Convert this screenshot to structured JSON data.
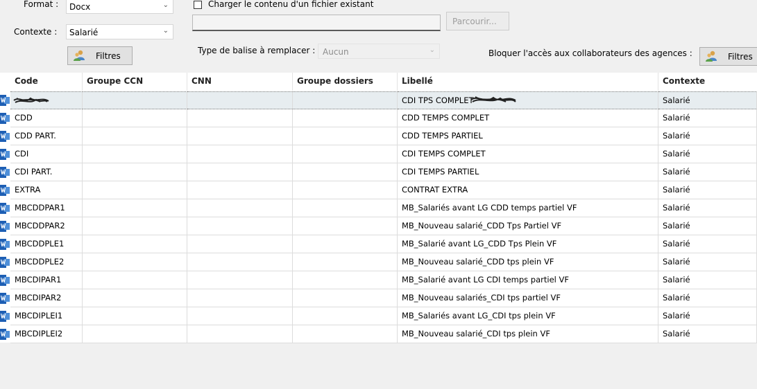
{
  "toolbar": {
    "format_label": "Format :",
    "format_value": "Docx",
    "contexte_label": "Contexte :",
    "contexte_value": "Salarié",
    "filtres_label": "Filtres",
    "load_checkbox_label": "Charger le contenu d'un fichier existant",
    "file_path_value": "",
    "browse_label": "Parcourir...",
    "tag_type_label": "Type de balise à remplacer :",
    "tag_type_value": "Aucun",
    "block_access_label": "Bloquer l'accès aux collaborateurs des agences :",
    "filtres_right_label": "Filtres"
  },
  "table": {
    "columns": [
      "Code",
      "Groupe CCN",
      "CNN",
      "Groupe dossiers",
      "Libellé",
      "Contexte"
    ],
    "rows": [
      {
        "code": "",
        "groupe_ccn": "",
        "cnn": "",
        "groupe_dossiers": "",
        "libelle": "CDI TPS COMPLET",
        "contexte": "Salarié"
      },
      {
        "code": "CDD",
        "groupe_ccn": "",
        "cnn": "",
        "groupe_dossiers": "",
        "libelle": "CDD TEMPS COMPLET",
        "contexte": "Salarié"
      },
      {
        "code": "CDD PART.",
        "groupe_ccn": "",
        "cnn": "",
        "groupe_dossiers": "",
        "libelle": "CDD TEMPS PARTIEL",
        "contexte": "Salarié"
      },
      {
        "code": "CDI",
        "groupe_ccn": "",
        "cnn": "",
        "groupe_dossiers": "",
        "libelle": "CDI TEMPS COMPLET",
        "contexte": "Salarié"
      },
      {
        "code": "CDI PART.",
        "groupe_ccn": "",
        "cnn": "",
        "groupe_dossiers": "",
        "libelle": "CDI TEMPS PARTIEL",
        "contexte": "Salarié"
      },
      {
        "code": "EXTRA",
        "groupe_ccn": "",
        "cnn": "",
        "groupe_dossiers": "",
        "libelle": "CONTRAT EXTRA",
        "contexte": "Salarié"
      },
      {
        "code": "MBCDDPAR1",
        "groupe_ccn": "",
        "cnn": "",
        "groupe_dossiers": "",
        "libelle": "MB_Salariés avant LG CDD temps partiel VF",
        "contexte": "Salarié"
      },
      {
        "code": "MBCDDPAR2",
        "groupe_ccn": "",
        "cnn": "",
        "groupe_dossiers": "",
        "libelle": "MB_Nouveau salarié_CDD Tps Partiel VF",
        "contexte": "Salarié"
      },
      {
        "code": "MBCDDPLE1",
        "groupe_ccn": "",
        "cnn": "",
        "groupe_dossiers": "",
        "libelle": "MB_Salarié avant LG_CDD Tps Plein VF",
        "contexte": "Salarié"
      },
      {
        "code": "MBCDDPLE2",
        "groupe_ccn": "",
        "cnn": "",
        "groupe_dossiers": "",
        "libelle": "MB_Nouveau salarié_CDD tps plein VF",
        "contexte": "Salarié"
      },
      {
        "code": "MBCDIPAR1",
        "groupe_ccn": "",
        "cnn": "",
        "groupe_dossiers": "",
        "libelle": "MB_Salarié avant LG CDI temps partiel VF",
        "contexte": "Salarié"
      },
      {
        "code": "MBCDIPAR2",
        "groupe_ccn": "",
        "cnn": "",
        "groupe_dossiers": "",
        "libelle": "MB_Nouveau salariés_CDI tps partiel VF",
        "contexte": "Salarié"
      },
      {
        "code": "MBCDIPLEI1",
        "groupe_ccn": "",
        "cnn": "",
        "groupe_dossiers": "",
        "libelle": "MB_Salariés avant LG_CDI tps plein VF",
        "contexte": "Salarié"
      },
      {
        "code": "MBCDIPLEI2",
        "groupe_ccn": "",
        "cnn": "",
        "groupe_dossiers": "",
        "libelle": "MB_Nouveau salarié_CDI tps plein VF",
        "contexte": "Salarié"
      }
    ]
  },
  "icons": {
    "filter": "users-filter-icon",
    "row": "word-document-icon",
    "chevron": "chevron-down-icon"
  },
  "colors": {
    "selected_row": "#e7edf0",
    "word_icon": "#1e5fb4"
  }
}
